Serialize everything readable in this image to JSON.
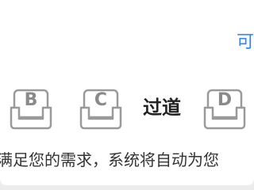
{
  "header": {
    "link_label": "可"
  },
  "seat_map": {
    "seats": [
      {
        "letter": "B"
      },
      {
        "letter": "C"
      },
      {
        "letter": "D"
      }
    ],
    "aisle_label": "过道"
  },
  "notice": {
    "text": "满足您的需求，系统将自动为您"
  },
  "colors": {
    "link": "#2f86e4",
    "seat_outline": "#9a9a9a",
    "seat_fill": "#ffffff",
    "text_primary": "#222222"
  }
}
